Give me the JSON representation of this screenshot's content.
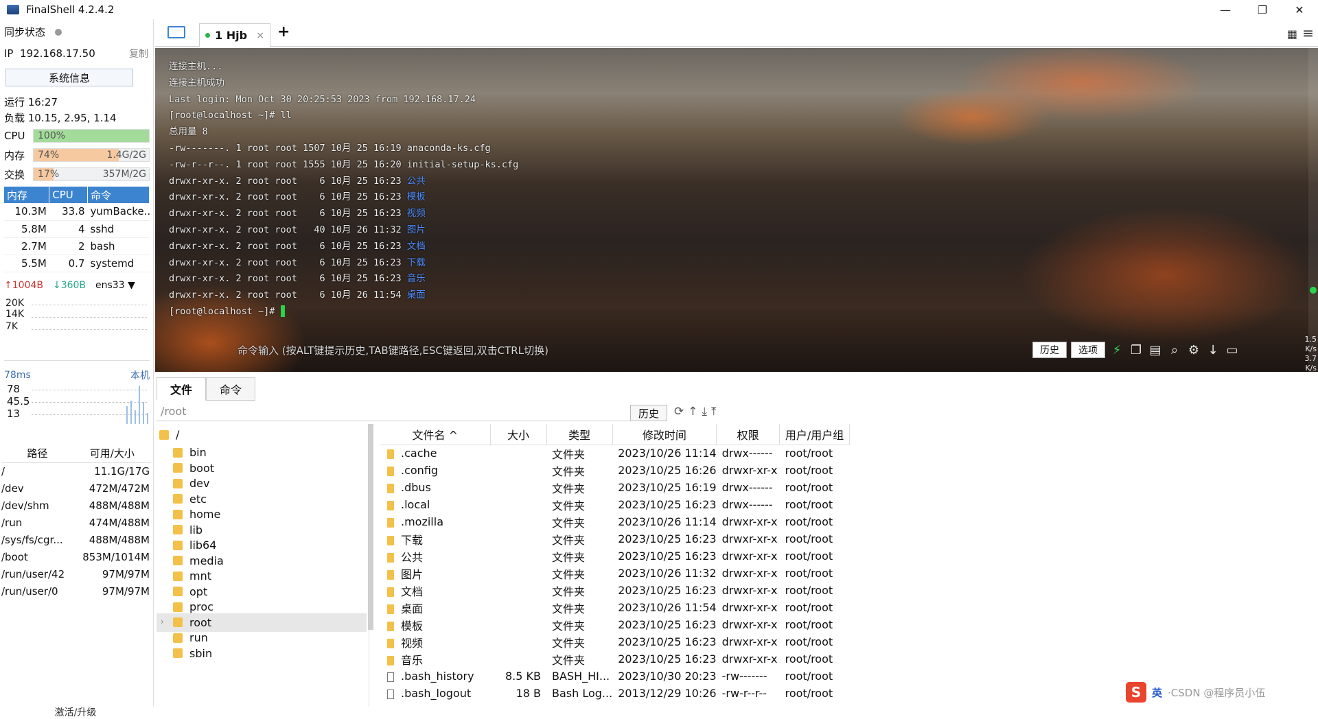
{
  "window": {
    "title": "FinalShell 4.2.4.2",
    "minimize": "—",
    "maximize": "❐",
    "close": "✕"
  },
  "sidebar": {
    "sync_label": "同步状态",
    "ip_label": "IP",
    "ip": "192.168.17.50",
    "copy": "复制",
    "sysinfo": "系统信息",
    "uptime": "运行 16:27",
    "load": "负载 10.15, 2.95, 1.14",
    "cpu": {
      "label": "CPU",
      "percent": "100%",
      "fraction": 1.0,
      "color": "#a3dc9a"
    },
    "mem": {
      "label": "内存",
      "percent": "74%",
      "amount": "1.4G/2G",
      "fraction": 0.74,
      "color": "#f7c9a0"
    },
    "swap": {
      "label": "交换",
      "percent": "17%",
      "amount": "357M/2G",
      "fraction": 0.17,
      "color": "#f7c9a0"
    },
    "proc_headers": [
      "内存",
      "CPU",
      "命令"
    ],
    "processes": [
      {
        "mem": "10.3M",
        "cpu": "33.8",
        "cmd": "yumBacke..."
      },
      {
        "mem": "5.8M",
        "cpu": "4",
        "cmd": "sshd"
      },
      {
        "mem": "2.7M",
        "cpu": "2",
        "cmd": "bash"
      },
      {
        "mem": "5.5M",
        "cpu": "0.7",
        "cmd": "systemd"
      }
    ],
    "net": {
      "up": "1004B",
      "down": "360B",
      "iface": "ens33",
      "ticks": [
        "20K",
        "14K",
        "7K"
      ]
    },
    "ping": {
      "latency": "78ms",
      "host": "本机",
      "ticks": [
        "78",
        "45.5",
        "13"
      ]
    },
    "disk_headers": [
      "路径",
      "可用/大小"
    ],
    "disks": [
      {
        "path": "/",
        "size": "11.1G/17G"
      },
      {
        "path": "/dev",
        "size": "472M/472M"
      },
      {
        "path": "/dev/shm",
        "size": "488M/488M"
      },
      {
        "path": "/run",
        "size": "474M/488M"
      },
      {
        "path": "/sys/fs/cgr...",
        "size": "488M/488M"
      },
      {
        "path": "/boot",
        "size": "853M/1014M"
      },
      {
        "path": "/run/user/42",
        "size": "97M/97M"
      },
      {
        "path": "/run/user/0",
        "size": "97M/97M"
      }
    ],
    "activate": "激活/升级"
  },
  "tabs": {
    "session_label": "1 Hjb",
    "close": "×",
    "add": "+"
  },
  "terminal": {
    "lines": [
      "连接主机...",
      "连接主机成功",
      "Last login: Mon Oct 30 20:25:53 2023 from 192.168.17.24",
      "[root@localhost ~]# ll",
      "总用量 8"
    ],
    "listing": [
      {
        "perm": "-rw-------.",
        "n": "1",
        "u": "root",
        "g": "root",
        "size": "1507",
        "date": "10月 25 16:19",
        "name": "anaconda-ks.cfg",
        "dir": false
      },
      {
        "perm": "-rw-r--r--.",
        "n": "1",
        "u": "root",
        "g": "root",
        "size": "1555",
        "date": "10月 25 16:20",
        "name": "initial-setup-ks.cfg",
        "dir": false
      },
      {
        "perm": "drwxr-xr-x.",
        "n": "2",
        "u": "root",
        "g": "root",
        "size": "6",
        "date": "10月 25 16:23",
        "name": "公共",
        "dir": true
      },
      {
        "perm": "drwxr-xr-x.",
        "n": "2",
        "u": "root",
        "g": "root",
        "size": "6",
        "date": "10月 25 16:23",
        "name": "模板",
        "dir": true
      },
      {
        "perm": "drwxr-xr-x.",
        "n": "2",
        "u": "root",
        "g": "root",
        "size": "6",
        "date": "10月 25 16:23",
        "name": "视频",
        "dir": true
      },
      {
        "perm": "drwxr-xr-x.",
        "n": "2",
        "u": "root",
        "g": "root",
        "size": "40",
        "date": "10月 26 11:32",
        "name": "图片",
        "dir": true
      },
      {
        "perm": "drwxr-xr-x.",
        "n": "2",
        "u": "root",
        "g": "root",
        "size": "6",
        "date": "10月 25 16:23",
        "name": "文档",
        "dir": true
      },
      {
        "perm": "drwxr-xr-x.",
        "n": "2",
        "u": "root",
        "g": "root",
        "size": "6",
        "date": "10月 25 16:23",
        "name": "下载",
        "dir": true
      },
      {
        "perm": "drwxr-xr-x.",
        "n": "2",
        "u": "root",
        "g": "root",
        "size": "6",
        "date": "10月 25 16:23",
        "name": "音乐",
        "dir": true
      },
      {
        "perm": "drwxr-xr-x.",
        "n": "2",
        "u": "root",
        "g": "root",
        "size": "6",
        "date": "10月 26 11:54",
        "name": "桌面",
        "dir": true
      }
    ],
    "prompt": "[root@localhost ~]#",
    "cmd_hint": "命令输入 (按ALT键提示历史,TAB键路径,ESC键返回,双击CTRL切换)",
    "history_btn": "历史",
    "options_btn": "选项",
    "side_up": "1.5",
    "side_down": "3.7",
    "side_unit": "K/s"
  },
  "bottom": {
    "tabs": [
      "文件",
      "命令"
    ],
    "path": "/root",
    "history_btn": "历史",
    "tree_root": "/",
    "tree": [
      "bin",
      "boot",
      "dev",
      "etc",
      "home",
      "lib",
      "lib64",
      "media",
      "mnt",
      "opt",
      "proc",
      "root",
      "run",
      "sbin"
    ],
    "selected": "root",
    "file_headers": [
      "文件名 ^",
      "大小",
      "类型",
      "修改时间",
      "权限",
      "用户/用户组"
    ],
    "files": [
      {
        "name": ".cache",
        "size": "",
        "type": "文件夹",
        "mtime": "2023/10/26 11:14",
        "perm": "drwx------",
        "owner": "root/root",
        "dir": true
      },
      {
        "name": ".config",
        "size": "",
        "type": "文件夹",
        "mtime": "2023/10/25 16:26",
        "perm": "drwxr-xr-x",
        "owner": "root/root",
        "dir": true
      },
      {
        "name": ".dbus",
        "size": "",
        "type": "文件夹",
        "mtime": "2023/10/25 16:19",
        "perm": "drwx------",
        "owner": "root/root",
        "dir": true
      },
      {
        "name": ".local",
        "size": "",
        "type": "文件夹",
        "mtime": "2023/10/25 16:23",
        "perm": "drwx------",
        "owner": "root/root",
        "dir": true
      },
      {
        "name": ".mozilla",
        "size": "",
        "type": "文件夹",
        "mtime": "2023/10/26 11:14",
        "perm": "drwxr-xr-x",
        "owner": "root/root",
        "dir": true
      },
      {
        "name": "下载",
        "size": "",
        "type": "文件夹",
        "mtime": "2023/10/25 16:23",
        "perm": "drwxr-xr-x",
        "owner": "root/root",
        "dir": true
      },
      {
        "name": "公共",
        "size": "",
        "type": "文件夹",
        "mtime": "2023/10/25 16:23",
        "perm": "drwxr-xr-x",
        "owner": "root/root",
        "dir": true
      },
      {
        "name": "图片",
        "size": "",
        "type": "文件夹",
        "mtime": "2023/10/26 11:32",
        "perm": "drwxr-xr-x",
        "owner": "root/root",
        "dir": true
      },
      {
        "name": "文档",
        "size": "",
        "type": "文件夹",
        "mtime": "2023/10/25 16:23",
        "perm": "drwxr-xr-x",
        "owner": "root/root",
        "dir": true
      },
      {
        "name": "桌面",
        "size": "",
        "type": "文件夹",
        "mtime": "2023/10/26 11:54",
        "perm": "drwxr-xr-x",
        "owner": "root/root",
        "dir": true
      },
      {
        "name": "模板",
        "size": "",
        "type": "文件夹",
        "mtime": "2023/10/25 16:23",
        "perm": "drwxr-xr-x",
        "owner": "root/root",
        "dir": true
      },
      {
        "name": "视频",
        "size": "",
        "type": "文件夹",
        "mtime": "2023/10/25 16:23",
        "perm": "drwxr-xr-x",
        "owner": "root/root",
        "dir": true
      },
      {
        "name": "音乐",
        "size": "",
        "type": "文件夹",
        "mtime": "2023/10/25 16:23",
        "perm": "drwxr-xr-x",
        "owner": "root/root",
        "dir": true
      },
      {
        "name": ".bash_history",
        "size": "8.5 KB",
        "type": "BASH_HI...",
        "mtime": "2023/10/30 20:23",
        "perm": "-rw-------",
        "owner": "root/root",
        "dir": false
      },
      {
        "name": ".bash_logout",
        "size": "18 B",
        "type": "Bash Log...",
        "mtime": "2013/12/29 10:26",
        "perm": "-rw-r--r--",
        "owner": "root/root",
        "dir": false
      }
    ]
  },
  "ime": {
    "logo": "S",
    "lang": "英",
    "watermark": "·CSDN @程序员小伍"
  }
}
